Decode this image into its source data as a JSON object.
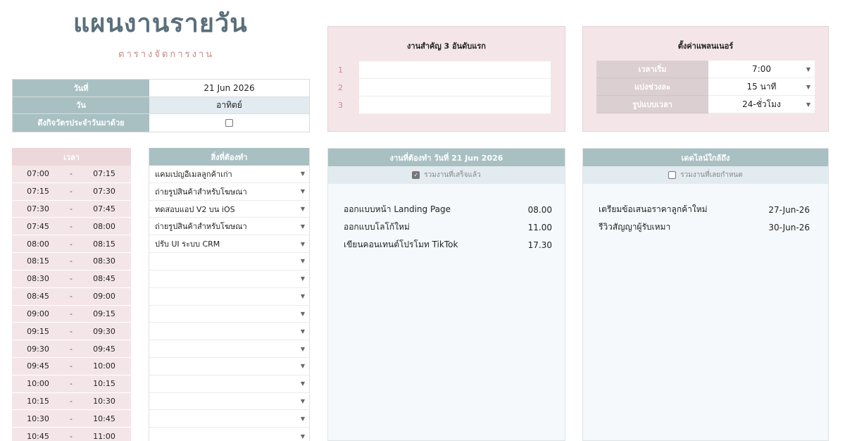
{
  "header": {
    "title": "แผนงานรายวัน",
    "subtitle": "ตารางจัดการงาน"
  },
  "info": {
    "date_label": "วันที่",
    "date_value": "21 Jun 2026",
    "day_label": "วัน",
    "day_value": "อาทิตย์",
    "routine_label": "ดึงกิจวัตรประจำวันมาด้วย"
  },
  "priorities": {
    "title": "งานสำคัญ 3 อันดับแรก",
    "numbers": [
      "1",
      "2",
      "3"
    ]
  },
  "settings": {
    "title": "ตั้งค่าแพลนเนอร์",
    "rows": [
      {
        "label": "เวลาเริ่ม",
        "value": "7:00"
      },
      {
        "label": "แบ่งช่วงละ",
        "value": "15 นาที"
      },
      {
        "label": "รูปแบบเวลา",
        "value": "24-ชั่วโมง"
      }
    ]
  },
  "time_column": {
    "header": "เวลา",
    "slots": [
      {
        "start": "07:00",
        "end": "07:15"
      },
      {
        "start": "07:15",
        "end": "07:30"
      },
      {
        "start": "07:30",
        "end": "07:45"
      },
      {
        "start": "07:45",
        "end": "08:00"
      },
      {
        "start": "08:00",
        "end": "08:15"
      },
      {
        "start": "08:15",
        "end": "08:30"
      },
      {
        "start": "08:30",
        "end": "08:45"
      },
      {
        "start": "08:45",
        "end": "09:00"
      },
      {
        "start": "09:00",
        "end": "09:15"
      },
      {
        "start": "09:15",
        "end": "09:30"
      },
      {
        "start": "09:30",
        "end": "09:45"
      },
      {
        "start": "09:45",
        "end": "10:00"
      },
      {
        "start": "10:00",
        "end": "10:15"
      },
      {
        "start": "10:15",
        "end": "10:30"
      },
      {
        "start": "10:30",
        "end": "10:45"
      },
      {
        "start": "10:45",
        "end": "11:00"
      }
    ]
  },
  "todo_column": {
    "header": "สิ่งที่ต้องทำ",
    "items": [
      "แคมเปญอีเมลลูกค้าเก่า",
      "ถ่ายรูปสินค้าสำหรับโฆษณา",
      "ทดสอบแอป V2 บน iOS",
      "ถ่ายรูปสินค้าสำหรับโฆษณา",
      "ปรับ UI ระบบ CRM",
      "",
      "",
      "",
      "",
      "",
      "",
      "",
      "",
      "",
      "",
      ""
    ]
  },
  "tasks_today": {
    "header": "งานที่ต้องทำ วันที่ 21 Jun 2026",
    "include_done_label": "รวมงานที่เสร็จแล้ว",
    "items": [
      {
        "name": "ออกแบบหน้า Landing Page",
        "time": "08.00"
      },
      {
        "name": "ออกแบบโลโก้ใหม่",
        "time": "11.00"
      },
      {
        "name": "เขียนคอนเทนต์โปรโมท TikTok",
        "time": "17.30"
      }
    ]
  },
  "deadlines": {
    "header": "เดดไลน์ใกล้ถึง",
    "include_overdue_label": "รวมงานที่เลยกำหนด",
    "items": [
      {
        "name": "เตรียมข้อเสนอราคาลูกค้าใหม่",
        "date": "27-Jun-26"
      },
      {
        "name": "รีวิวสัญญาผู้รับเหมา",
        "date": "30-Jun-26"
      }
    ]
  },
  "icons": {
    "dropdown": "chevron-down-icon",
    "checkbox": "checkbox-icon",
    "check": "check-icon"
  },
  "colors": {
    "header_teal": "#a9c0c3",
    "pink_panel": "#f4e6e8",
    "title": "#5a6f7b"
  }
}
